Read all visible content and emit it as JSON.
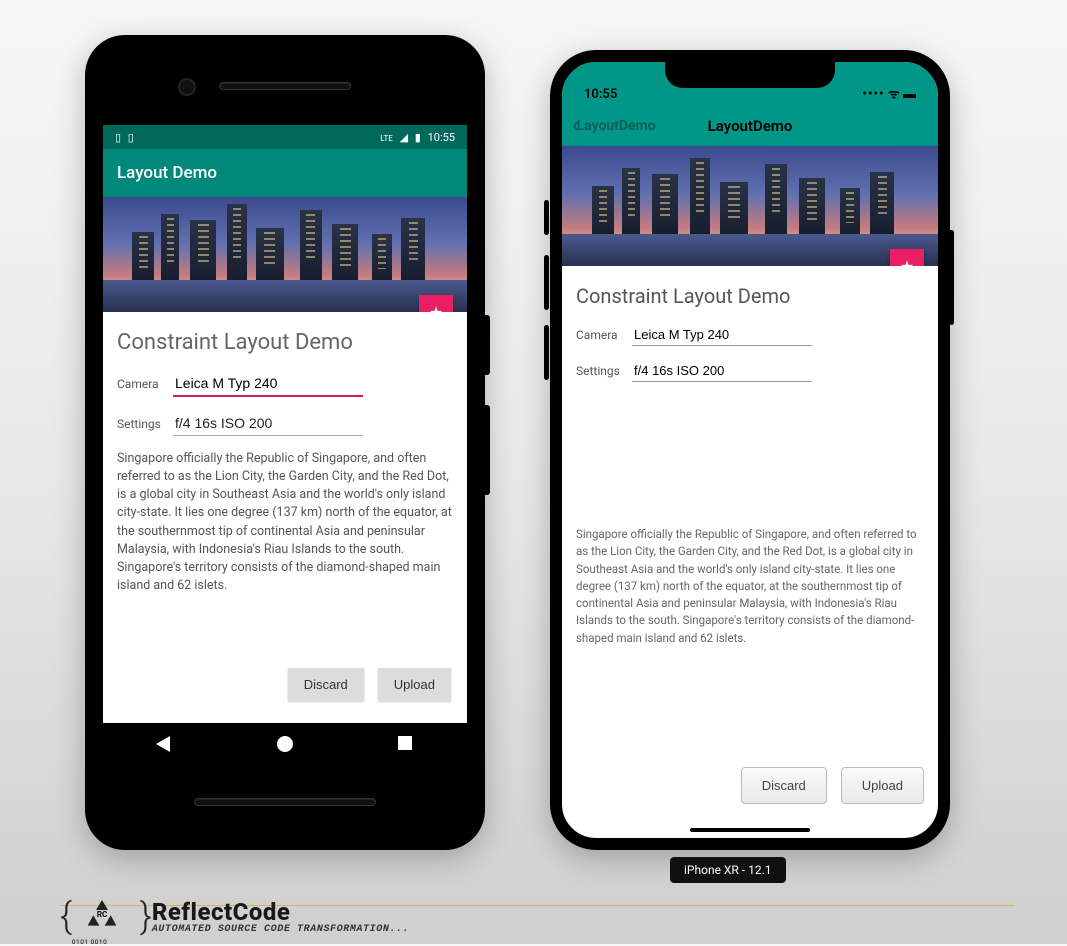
{
  "android": {
    "status": {
      "time": "10:55",
      "icons_left": [
        "sim-icon",
        "sd-icon"
      ],
      "icons_right": [
        "lte-icon",
        "signal-icon",
        "battery-icon"
      ]
    },
    "appbar_title": "Layout Demo",
    "page_title": "Constraint Layout Demo",
    "fields": {
      "camera": {
        "label": "Camera",
        "value": "Leica M Typ 240"
      },
      "settings": {
        "label": "Settings",
        "value": "f/4 16s ISO 200"
      }
    },
    "description": "Singapore officially the Republic of Singapore, and often referred to as the Lion City, the Garden City, and the Red Dot, is a global city in Southeast Asia and the world's only island city-state. It lies one degree (137 km) north of the equator, at the southernmost tip of continental Asia and peninsular Malaysia, with Indonesia's Riau Islands to the south. Singapore's territory consists of the diamond-shaped main island and 62 islets.",
    "buttons": {
      "discard": "Discard",
      "upload": "Upload"
    }
  },
  "ios": {
    "status": {
      "time": "10:55"
    },
    "nav": {
      "back": "LayoutDemo",
      "title": "LayoutDemo"
    },
    "page_title": "Constraint Layout Demo",
    "fields": {
      "camera": {
        "label": "Camera",
        "value": "Leica M Typ 240"
      },
      "settings": {
        "label": "Settings",
        "value": "f/4 16s ISO 200"
      }
    },
    "description": "Singapore officially the Republic of Singapore, and often referred to as the Lion City, the Garden City, and the Red Dot, is a global city in Southeast Asia and the world's only island city-state. It lies one degree (137 km) north of the equator, at the southernmost tip of continental Asia and peninsular Malaysia, with Indonesia's Riau Islands to the south. Singapore's territory consists of the diamond-shaped main island and 62 islets.",
    "buttons": {
      "discard": "Discard",
      "upload": "Upload"
    },
    "device_label": "iPhone XR - 12.1"
  },
  "footer": {
    "brand": "ReflectCode",
    "tagline": "AUTOMATED SOURCE CODE TRANSFORMATION...",
    "bits": "0101 0010"
  }
}
